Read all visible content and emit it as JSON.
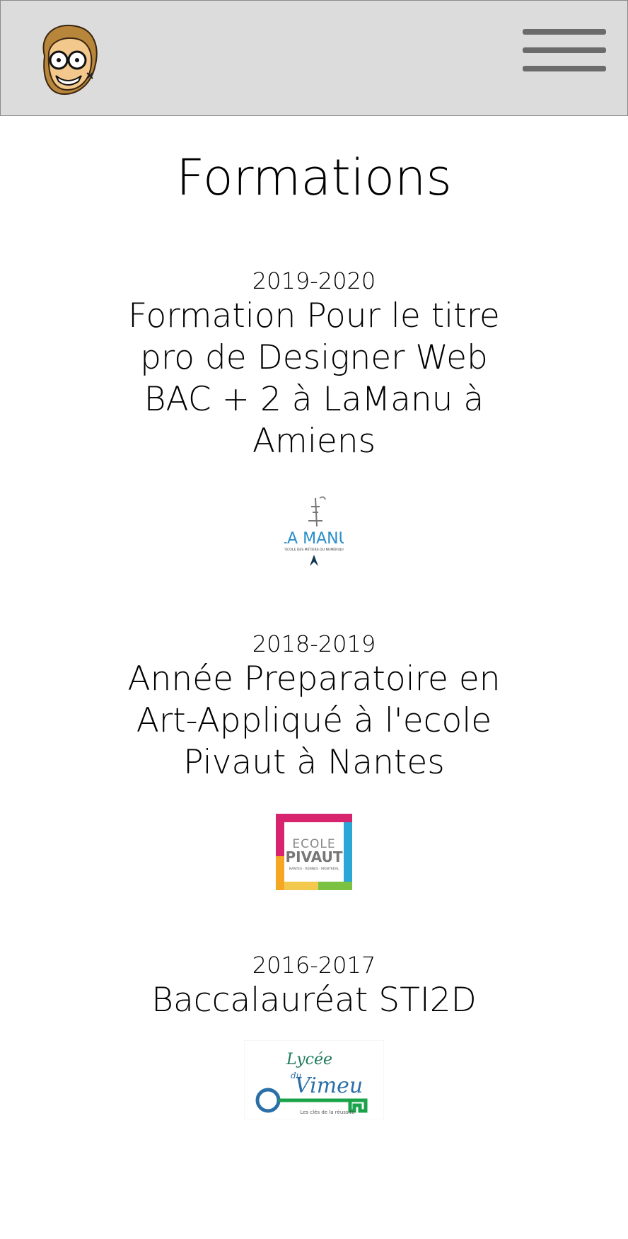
{
  "header": {
    "avatar_icon": "cartoon-avatar-icon",
    "menu_icon": "hamburger-menu-icon",
    "background": "#dcdcdc"
  },
  "page": {
    "title": "Formations"
  },
  "formations": [
    {
      "year": "2019-2020",
      "title": "Formation Pour le titre pro de Designer Web BAC + 2 à LaManu à Amiens",
      "logo": {
        "text": "LA MANU",
        "subtitle": "L'ÉCOLE DES MÉTIERS DU NUMÉRIQUE",
        "color": "#2a8dc9"
      }
    },
    {
      "year": "2018-2019",
      "title": "Année Preparatoire en Art-Appliqué à l'ecole Pivaut à Nantes",
      "logo": {
        "line1": "ECOLE",
        "line2": "PIVAUT",
        "line3": "NANTES · RENNES · MONTRÉAL"
      }
    },
    {
      "year": "2016-2017",
      "title": "Baccalauréat STI2D",
      "logo": {
        "line1": "Lycée",
        "line2": "du",
        "line3": "Vimeu",
        "tagline": "Les clés de la réussite"
      }
    }
  ]
}
